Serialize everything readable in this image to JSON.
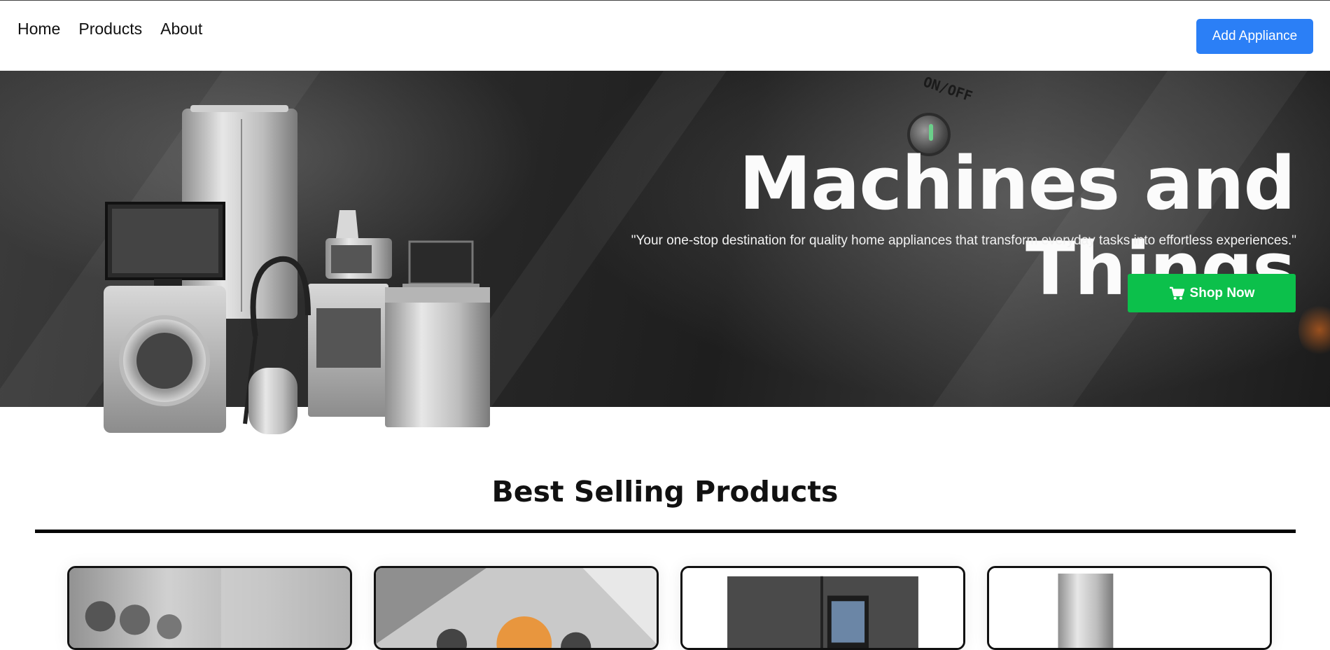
{
  "nav": {
    "links": [
      "Home",
      "Products",
      "About"
    ],
    "add_button": "Add Appliance"
  },
  "hero": {
    "title": "Machines and Things",
    "subtitle": "\"Your one-stop destination for quality home appliances that transform everyday tasks into effortless experiences.\"",
    "shop_button": "Shop Now",
    "background_label": "ON/OFF"
  },
  "section": {
    "title": "Best Selling Products"
  },
  "colors": {
    "add_button": "#2b7ff6",
    "shop_button": "#0cc04b",
    "rule": "#050505"
  },
  "icons": {
    "shop": "shopping-cart-icon"
  }
}
